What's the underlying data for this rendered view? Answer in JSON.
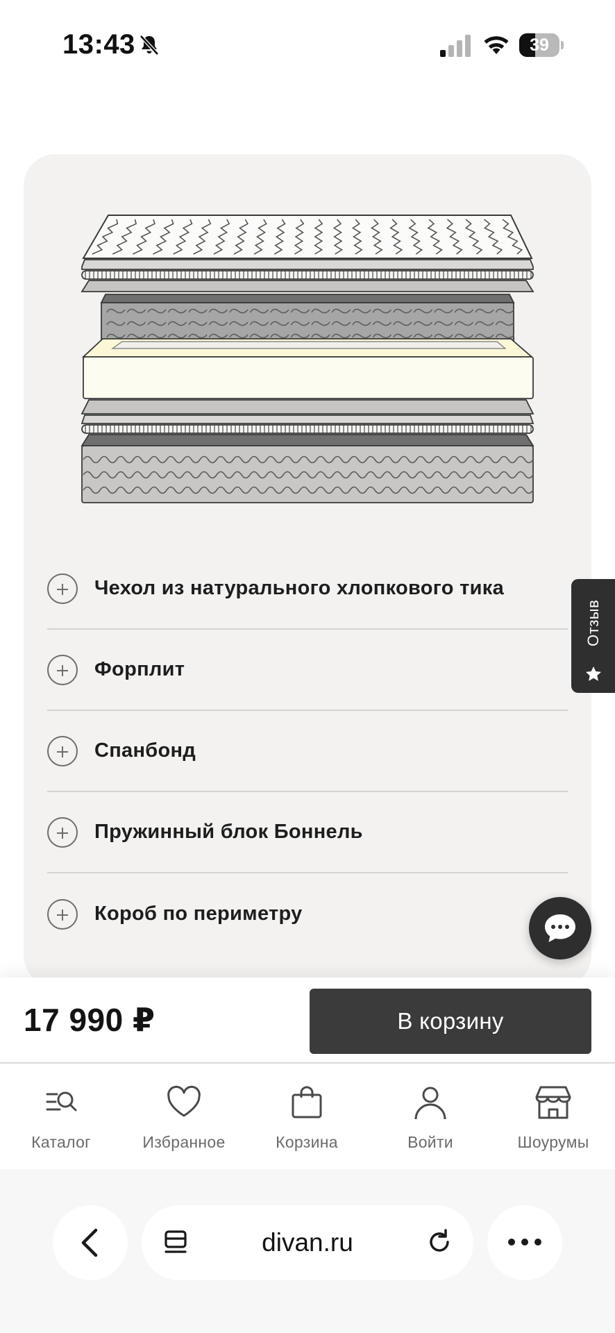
{
  "status_bar": {
    "time": "13:43",
    "battery_level": "39",
    "battery_fraction": 0.39,
    "icons": [
      "bell-slash-icon",
      "signal-icon",
      "wifi-icon",
      "battery-icon"
    ]
  },
  "product": {
    "image_icon": "mattress-layers-illustration",
    "layers": [
      {
        "label": "Чехол из натурального хлопкового тика"
      },
      {
        "label": "Форплит"
      },
      {
        "label": "Спанбонд"
      },
      {
        "label": "Пружинный блок Боннель"
      },
      {
        "label": "Короб по периметру"
      }
    ]
  },
  "review_tab": {
    "label": "Отзыв",
    "icon": "star-icon"
  },
  "chat": {
    "icon": "chat-bubble-icon"
  },
  "buy_bar": {
    "price": "17 990 ₽",
    "cart_button": "В корзину"
  },
  "bottom_nav": {
    "items": [
      {
        "label": "Каталог",
        "icon": "catalog-search-icon"
      },
      {
        "label": "Избранное",
        "icon": "heart-icon"
      },
      {
        "label": "Корзина",
        "icon": "bag-icon"
      },
      {
        "label": "Войти",
        "icon": "user-icon"
      },
      {
        "label": "Шоурумы",
        "icon": "store-icon"
      }
    ]
  },
  "browser": {
    "url": "divan.ru",
    "icons": [
      "back-icon",
      "tabs-icon",
      "reload-icon",
      "more-icon"
    ]
  },
  "colors": {
    "card_background": "#f3f2f1",
    "primary_dark": "#3b3b3b",
    "foam_layer": "#fbf9ec"
  }
}
